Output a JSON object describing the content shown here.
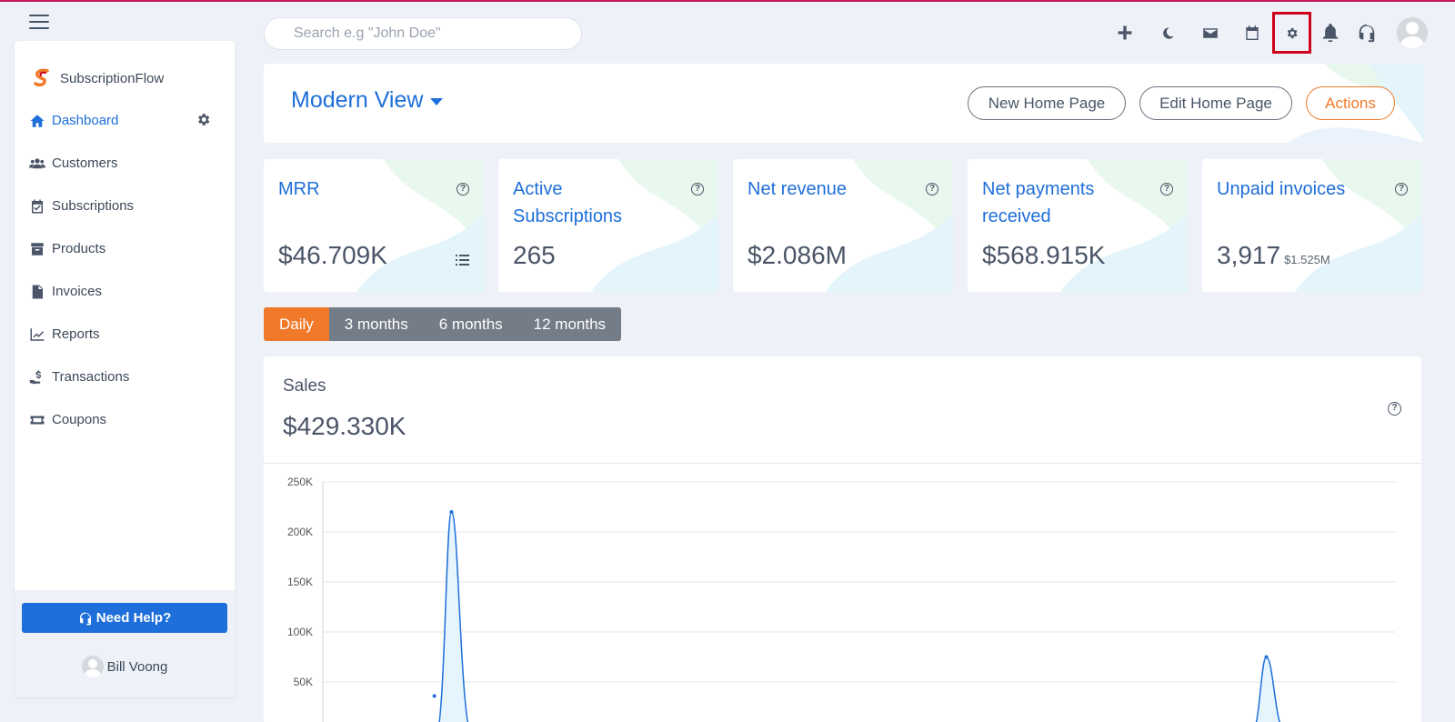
{
  "brand": {
    "name": "SubscriptionFlow"
  },
  "sidebar": {
    "items": [
      {
        "label": "Dashboard",
        "icon": "home-icon",
        "active": true
      },
      {
        "label": "Customers",
        "icon": "users-icon"
      },
      {
        "label": "Subscriptions",
        "icon": "calendar-check-icon"
      },
      {
        "label": "Products",
        "icon": "archive-icon"
      },
      {
        "label": "Invoices",
        "icon": "invoice-icon"
      },
      {
        "label": "Reports",
        "icon": "line-chart-icon"
      },
      {
        "label": "Transactions",
        "icon": "hand-dollar-icon"
      },
      {
        "label": "Coupons",
        "icon": "ticket-icon"
      }
    ],
    "help_label": "Need Help?",
    "user_name": "Bill Voong"
  },
  "search": {
    "placeholder": "Search e.g \"John Doe\""
  },
  "topbar": {
    "icons": [
      "plus-icon",
      "moon-icon",
      "mail-icon",
      "calendar-icon",
      "gear-icon",
      "bell-icon",
      "headset-icon",
      "avatar"
    ]
  },
  "header": {
    "view_title": "Modern View",
    "new_home_label": "New Home Page",
    "edit_home_label": "Edit Home Page",
    "actions_label": "Actions"
  },
  "kpis": [
    {
      "title": "MRR",
      "value": "$46.709K"
    },
    {
      "title": "Active Subscriptions",
      "value": "265"
    },
    {
      "title": "Net revenue",
      "value": "$2.086M"
    },
    {
      "title": "Net payments received",
      "value": "$568.915K"
    },
    {
      "title": "Unpaid invoices",
      "value": "3,917",
      "sub": "$1.525M"
    }
  ],
  "periods": [
    "Daily",
    "3 months",
    "6 months",
    "12 months"
  ],
  "active_period": "Daily",
  "sales": {
    "title": "Sales",
    "value": "$429.330K"
  },
  "colors": {
    "accent": "#1e6fd9",
    "orange": "#f07a2a",
    "tab_gray": "#747c88",
    "highlight": "#d0021b"
  },
  "chart_data": {
    "type": "area",
    "y_ticks": [
      "250K",
      "200K",
      "150K",
      "100K",
      "50K"
    ],
    "ylim": [
      0,
      250000
    ],
    "series": [
      {
        "points": [
          [
            0,
            0
          ],
          [
            0.1,
            36000
          ],
          [
            0.12,
            220000
          ],
          [
            0.14,
            0
          ],
          [
            0.86,
            0
          ],
          [
            0.88,
            75000
          ],
          [
            0.9,
            0
          ]
        ]
      }
    ]
  }
}
